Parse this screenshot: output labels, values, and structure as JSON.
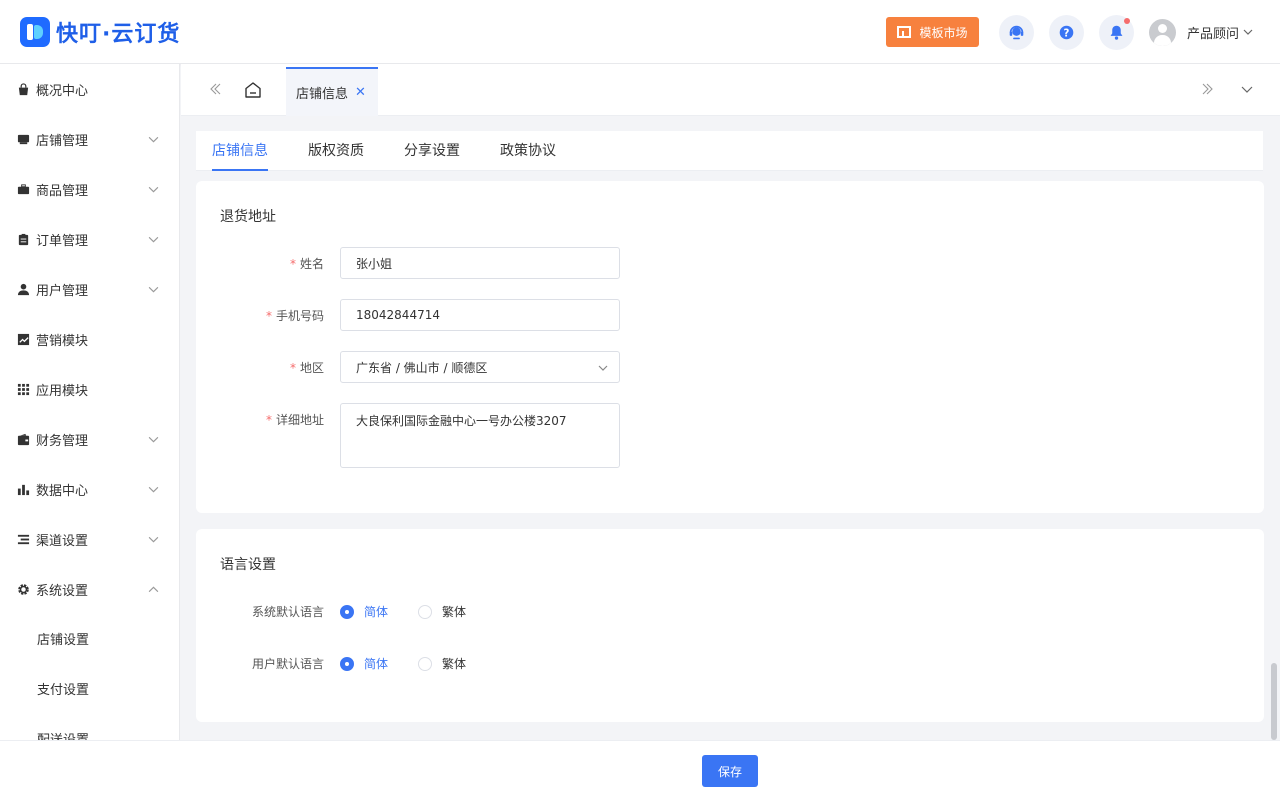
{
  "header": {
    "brand": "快叮·云订货",
    "template_market": "模板市场",
    "user_name": "产品顾问"
  },
  "sidebar": {
    "items": [
      {
        "label": "概况中心",
        "icon": "bag-icon",
        "has_caret": false
      },
      {
        "label": "店铺管理",
        "icon": "store-icon",
        "has_caret": true
      },
      {
        "label": "商品管理",
        "icon": "briefcase-icon",
        "has_caret": true
      },
      {
        "label": "订单管理",
        "icon": "clipboard-icon",
        "has_caret": true
      },
      {
        "label": "用户管理",
        "icon": "user-icon",
        "has_caret": true
      },
      {
        "label": "营销模块",
        "icon": "chart-icon",
        "has_caret": false
      },
      {
        "label": "应用模块",
        "icon": "grid-icon",
        "has_caret": false
      },
      {
        "label": "财务管理",
        "icon": "wallet-icon",
        "has_caret": true
      },
      {
        "label": "数据中心",
        "icon": "bar-chart-icon",
        "has_caret": true
      },
      {
        "label": "渠道设置",
        "icon": "list-icon",
        "has_caret": true
      },
      {
        "label": "系统设置",
        "icon": "gear-icon",
        "has_caret": true,
        "expanded": true
      }
    ],
    "sub_items": [
      {
        "label": "店铺设置"
      },
      {
        "label": "支付设置"
      },
      {
        "label": "配送设置"
      }
    ]
  },
  "tabs": {
    "open_tab": "店铺信息"
  },
  "subtabs": [
    "店铺信息",
    "版权资质",
    "分享设置",
    "政策协议"
  ],
  "return_address": {
    "title": "退货地址",
    "name_label": "姓名",
    "name_value": "张小姐",
    "phone_label": "手机号码",
    "phone_value": "18042844714",
    "region_label": "地区",
    "region_value": "广东省 / 佛山市 / 顺德区",
    "detail_label": "详细地址",
    "detail_value": "大良保利国际金融中心一号办公楼3207",
    "required_mark": "*"
  },
  "language": {
    "title": "语言设置",
    "system_label": "系统默认语言",
    "user_label": "用户默认语言",
    "option_simplified": "简体",
    "option_traditional": "繁体",
    "system_selected": "简体",
    "user_selected": "简体"
  },
  "footer": {
    "save_label": "保存"
  },
  "colors": {
    "primary": "#3a75f4",
    "template_button": "#f7813e",
    "required": "#f56c6c"
  }
}
